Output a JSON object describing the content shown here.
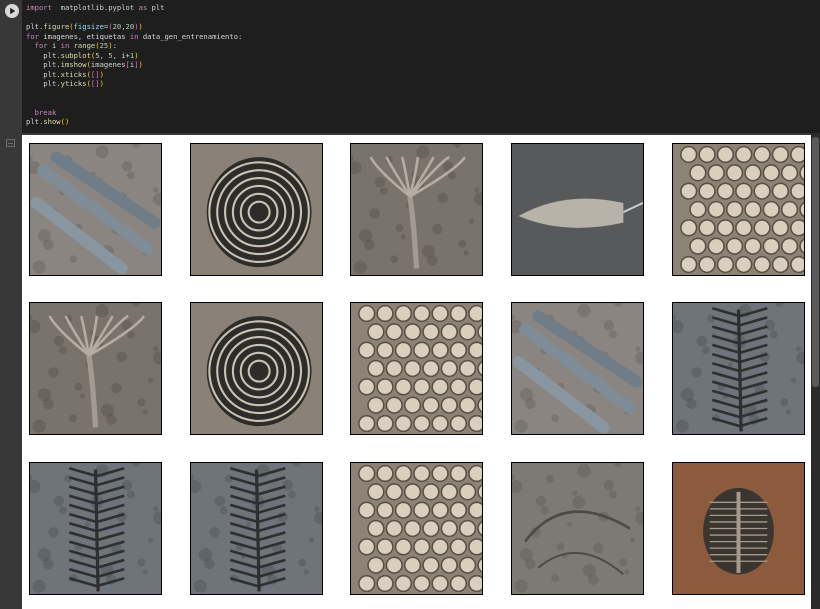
{
  "code_cell": {
    "lines": [
      [
        [
          "kw",
          "import"
        ],
        [
          "",
          "  matplotlib.pyplot "
        ],
        [
          "kw",
          "as"
        ],
        [
          "",
          " plt"
        ]
      ],
      [],
      [
        [
          "",
          "plt."
        ],
        [
          "fn",
          "figure"
        ],
        [
          "br",
          "("
        ],
        [
          "var",
          "figsize"
        ],
        [
          "",
          "="
        ],
        [
          "br2",
          "("
        ],
        [
          "num",
          "20"
        ],
        [
          "",
          ","
        ],
        [
          "num",
          "20"
        ],
        [
          "br2",
          ")"
        ],
        [
          "br",
          ")"
        ]
      ],
      [
        [
          "kw",
          "for"
        ],
        [
          "",
          " imagenes, etiquetas "
        ],
        [
          "kw",
          "in"
        ],
        [
          "",
          " data_gen_entrenamiento:"
        ]
      ],
      [
        [
          "",
          "  "
        ],
        [
          "kw",
          "for"
        ],
        [
          "",
          " i "
        ],
        [
          "kw",
          "in"
        ],
        [
          "",
          " "
        ],
        [
          "fn",
          "range"
        ],
        [
          "br",
          "("
        ],
        [
          "num",
          "25"
        ],
        [
          "br",
          ")"
        ],
        [
          "",
          ":"
        ]
      ],
      [
        [
          "",
          "    plt."
        ],
        [
          "fn",
          "subplot"
        ],
        [
          "br",
          "("
        ],
        [
          "num",
          "5"
        ],
        [
          "",
          ", "
        ],
        [
          "num",
          "5"
        ],
        [
          "",
          ", i+"
        ],
        [
          "num",
          "1"
        ],
        [
          "br",
          ")"
        ]
      ],
      [
        [
          "",
          "    plt."
        ],
        [
          "fn",
          "imshow"
        ],
        [
          "br",
          "("
        ],
        [
          "",
          "imagenes"
        ],
        [
          "br2",
          "["
        ],
        [
          "",
          "i"
        ],
        [
          "br2",
          "]"
        ],
        [
          "br",
          ")"
        ]
      ],
      [
        [
          "",
          "    plt."
        ],
        [
          "fn",
          "xticks"
        ],
        [
          "br",
          "("
        ],
        [
          "br2",
          "["
        ],
        [
          "br2",
          "]"
        ],
        [
          "br",
          ")"
        ]
      ],
      [
        [
          "",
          "    plt."
        ],
        [
          "fn",
          "yticks"
        ],
        [
          "br",
          "("
        ],
        [
          "br2",
          "["
        ],
        [
          "br2",
          "]"
        ],
        [
          "br",
          ")"
        ]
      ],
      [],
      [],
      [
        [
          "",
          "  "
        ],
        [
          "kw",
          "break"
        ]
      ],
      [
        [
          "",
          "plt."
        ],
        [
          "fn",
          "show"
        ],
        [
          "br",
          "("
        ],
        [
          "br",
          ")"
        ]
      ]
    ]
  },
  "output": {
    "tiles": [
      {
        "subject": "belemnite-fossils"
      },
      {
        "subject": "ammonite-fossil"
      },
      {
        "subject": "crinoid-fossil"
      },
      {
        "subject": "belemnite-fossil"
      },
      {
        "subject": "coral-fossil"
      },
      {
        "subject": "crinoid-fossil"
      },
      {
        "subject": "ammonite-fossil"
      },
      {
        "subject": "coral-fossil"
      },
      {
        "subject": "belemnite-fossils"
      },
      {
        "subject": "fern-fossil"
      },
      {
        "subject": "fern-fossil"
      },
      {
        "subject": "fern-fossil"
      },
      {
        "subject": "coral-fossil"
      },
      {
        "subject": "fossil-impression"
      },
      {
        "subject": "trilobite-fossil"
      }
    ]
  },
  "colors": {
    "editor_bg": "#1e1e1e",
    "chrome_bg": "#383838",
    "output_bg": "#ffffff"
  }
}
